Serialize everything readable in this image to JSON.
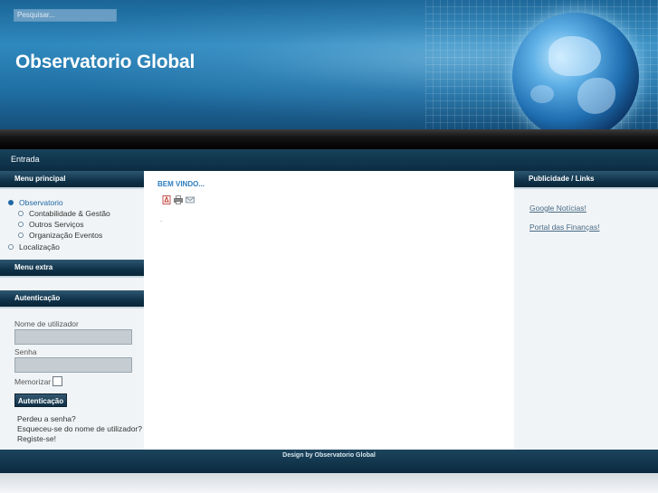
{
  "header": {
    "search_placeholder": "Pesquisar...",
    "site_title": "Observatorio Global"
  },
  "nav": {
    "items": [
      {
        "label": "Entrada"
      }
    ]
  },
  "left": {
    "main_menu": {
      "title": "Menu principal",
      "items": [
        {
          "label": "Observatorio",
          "active": true
        },
        {
          "label": "Contabilidade & Gestão"
        },
        {
          "label": "Outros Serviços"
        },
        {
          "label": "Organização Eventos"
        },
        {
          "label": "Localização"
        }
      ]
    },
    "extra_menu": {
      "title": "Menu extra"
    },
    "login": {
      "title": "Autenticação",
      "username_label": "Nome de utilizador",
      "password_label": "Senha",
      "remember_label": "Memorizar",
      "button_label": "Autenticação",
      "links": [
        {
          "label": "Perdeu a senha?"
        },
        {
          "label": "Esqueceu-se do nome de utilizador?"
        },
        {
          "label": "Registe-se!"
        }
      ]
    }
  },
  "main": {
    "title": "BEM VINDO...",
    "icons": [
      "pdf-icon",
      "print-icon",
      "email-icon"
    ],
    "body_text": "."
  },
  "right": {
    "title": "Publicidade / Links",
    "links": [
      {
        "label": "Google Notícias!"
      },
      {
        "label": "Portal das Finanças!"
      }
    ]
  },
  "footer": {
    "text": "Design by Observatorio Global"
  },
  "colors": {
    "accent": "#2d7dbf",
    "header_dark": "#0b2c42"
  }
}
